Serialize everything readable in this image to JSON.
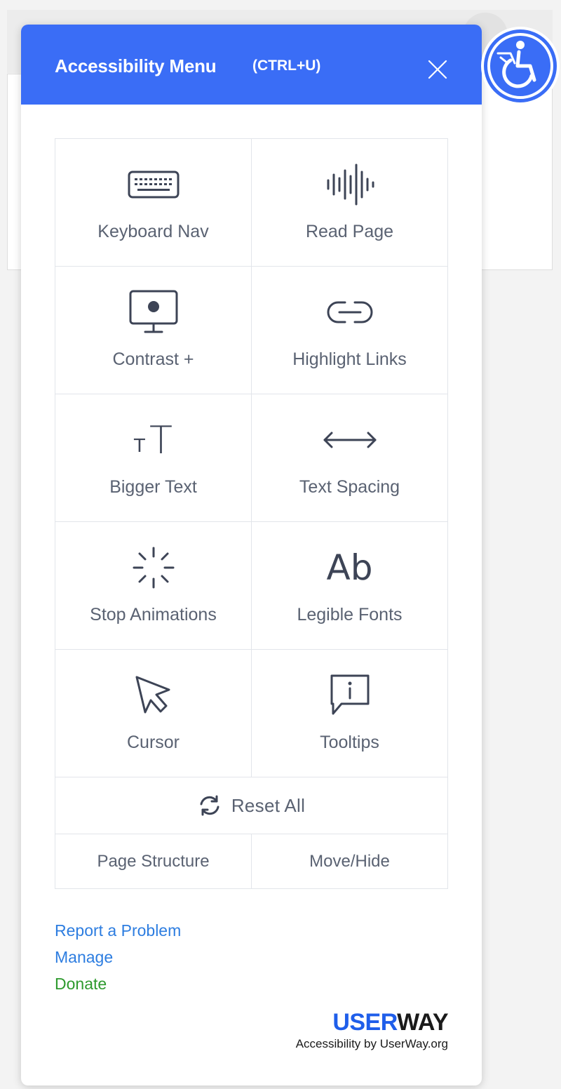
{
  "header": {
    "title": "Accessibility Menu",
    "shortcut": "(CTRL+U)"
  },
  "colors": {
    "accent": "#3a6df6",
    "link": "#2d7de0",
    "donate": "#2e9a2e",
    "icon": "#3d4456",
    "brand_blue": "#1f5eea",
    "brand_dark": "#1a1a1a"
  },
  "grid": {
    "rows": [
      [
        {
          "label": "Keyboard Nav",
          "icon": "keyboard-icon"
        },
        {
          "label": "Read Page",
          "icon": "soundwave-icon"
        }
      ],
      [
        {
          "label": "Contrast +",
          "icon": "monitor-icon"
        },
        {
          "label": "Highlight Links",
          "icon": "link-icon"
        }
      ],
      [
        {
          "label": "Bigger Text",
          "icon": "text-size-icon"
        },
        {
          "label": "Text Spacing",
          "icon": "arrows-horizontal-icon"
        }
      ],
      [
        {
          "label": "Stop Animations",
          "icon": "loader-icon"
        },
        {
          "label": "Legible Fonts",
          "icon": "font-icon"
        }
      ],
      [
        {
          "label": "Cursor",
          "icon": "cursor-icon"
        },
        {
          "label": "Tooltips",
          "icon": "tooltip-icon"
        }
      ]
    ],
    "reset_label": "Reset All",
    "bottom": {
      "page_structure": "Page Structure",
      "move_hide": "Move/Hide"
    }
  },
  "icons": {
    "text_size_small": "T",
    "text_size_large": "T",
    "font_sample": "Ab"
  },
  "links": {
    "report": "Report a Problem",
    "manage": "Manage",
    "donate": "Donate"
  },
  "brand": {
    "logo_part1": "USER",
    "logo_part2": "WAY",
    "tagline": "Accessibility by UserWay.org"
  }
}
